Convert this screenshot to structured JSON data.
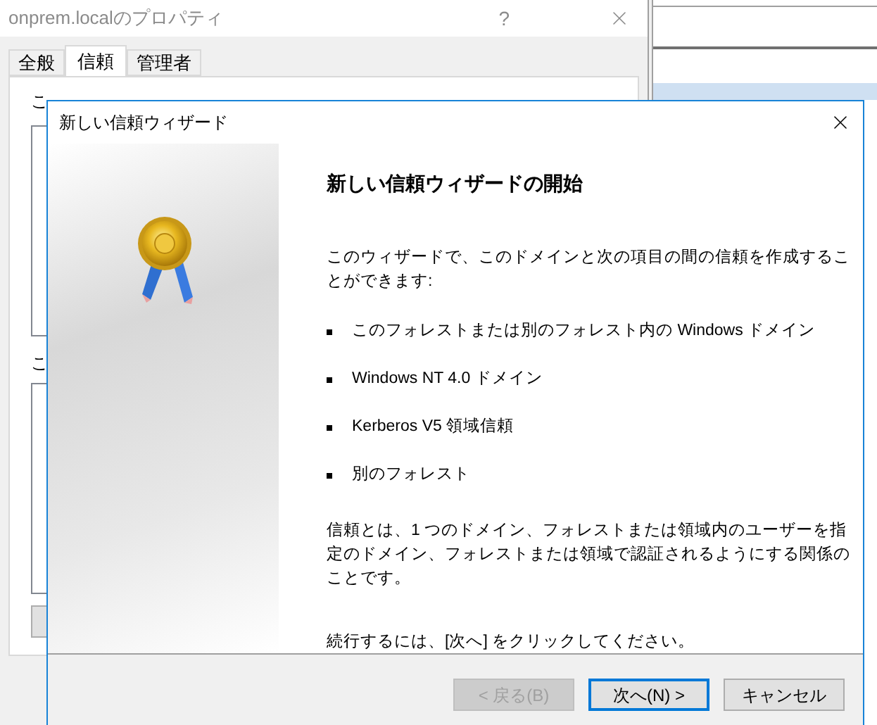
{
  "background_window": {
    "title": "onprem.localのプロパティ",
    "help": "?",
    "tabs": [
      {
        "label": "全般",
        "selected": false
      },
      {
        "label": "信頼",
        "selected": true
      },
      {
        "label": "管理者",
        "selected": false
      }
    ],
    "outgoing_label": "こ",
    "incoming_label": "こ"
  },
  "wizard": {
    "title": "新しい信頼ウィザード",
    "heading": "新しい信頼ウィザードの開始",
    "intro": "このウィザードで、このドメインと次の項目の間の信頼を作成することができます:",
    "items": [
      "このフォレストまたは別のフォレスト内の Windows ドメイン",
      "Windows NT 4.0 ドメイン",
      "Kerberos V5 領域信頼",
      "別のフォレスト"
    ],
    "definition": "信頼とは、1 つのドメイン、フォレストまたは領域内のユーザーを指定のドメイン、フォレストまたは領域で認証されるようにする関係のことです。",
    "instruction": "続行するには、[次へ] をクリックしてください。",
    "buttons": [
      {
        "label": "< 戻る(B)",
        "disabled": true,
        "default": false
      },
      {
        "label": "次へ(N) >",
        "disabled": false,
        "default": true
      },
      {
        "label": "キャンセル",
        "disabled": false,
        "default": false
      }
    ]
  }
}
